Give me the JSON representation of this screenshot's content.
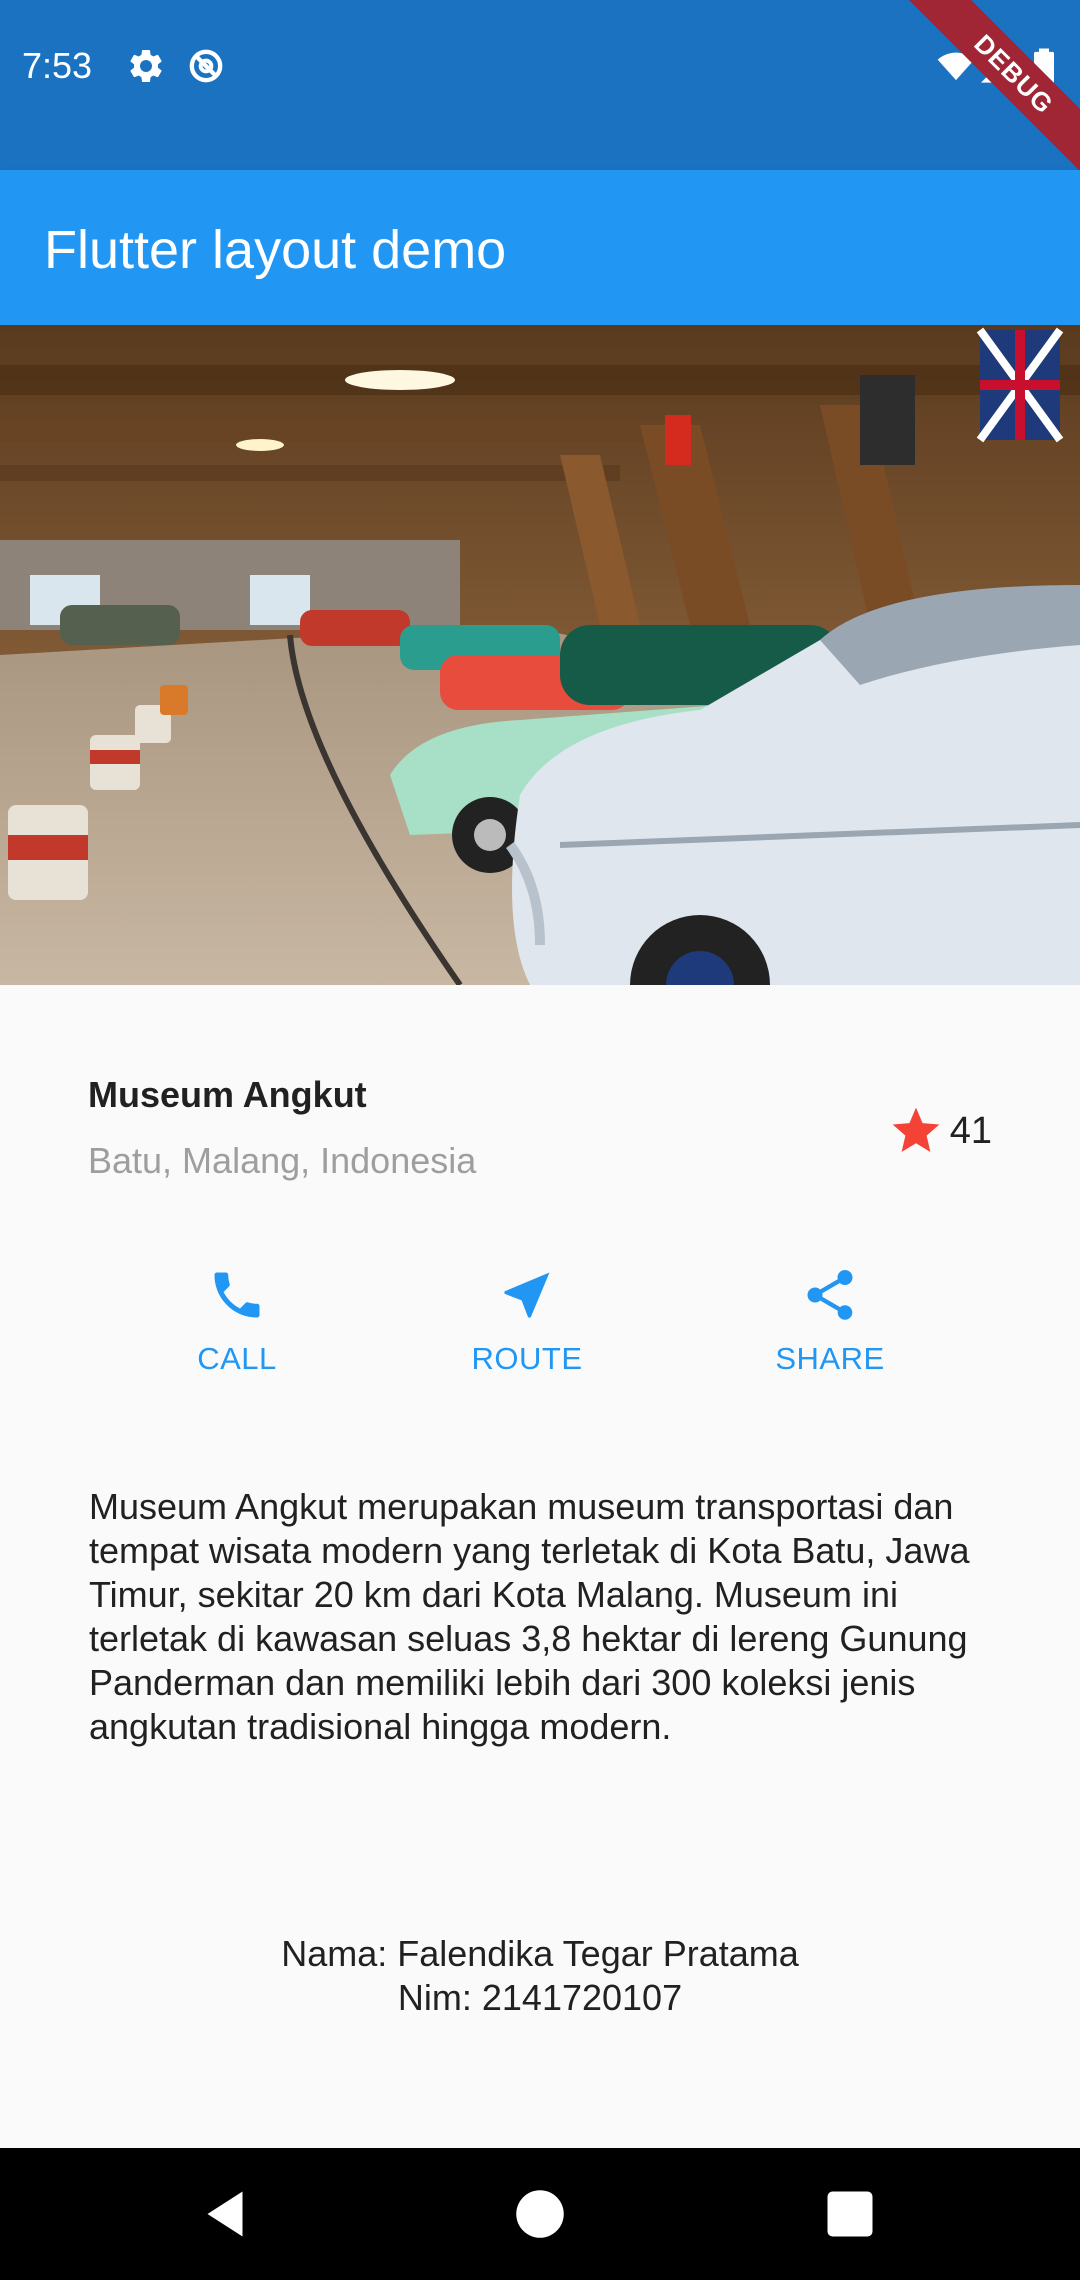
{
  "status_bar": {
    "time": "7:53",
    "left_icons": [
      "gear-icon",
      "no-sync-icon"
    ],
    "right_icons": [
      "wifi-icon",
      "cellular-icon",
      "battery-icon"
    ],
    "debug_banner": "DEBUG",
    "color": "#1b72c0"
  },
  "app_bar": {
    "title": "Flutter layout demo",
    "color": "#2196f3"
  },
  "hero_image": {
    "description_icon": "car-museum-photo"
  },
  "title_section": {
    "name": "Museum Angkut",
    "location": "Batu, Malang, Indonesia",
    "rating_icon": "star-icon",
    "rating_count": "41",
    "star_color": "#f44336"
  },
  "actions": [
    {
      "label": "CALL",
      "icon": "phone-icon"
    },
    {
      "label": "ROUTE",
      "icon": "navigation-arrow-icon"
    },
    {
      "label": "SHARE",
      "icon": "share-icon"
    }
  ],
  "description": "Museum Angkut merupakan museum transportasi dan tempat wisata modern yang terletak di Kota Batu, Jawa Timur, sekitar 20 km dari Kota Malang. Museum ini terletak di kawasan seluas 3,8 hektar di lereng Gunung Panderman dan memiliki lebih dari 300 koleksi jenis angkutan tradisional hingga modern.",
  "footer": {
    "name_line": "Nama: Falendika Tegar Pratama",
    "nim_line": "Nim: 2141720107"
  },
  "nav_bar": {
    "buttons": [
      "back-icon",
      "home-icon",
      "recents-icon"
    ]
  }
}
